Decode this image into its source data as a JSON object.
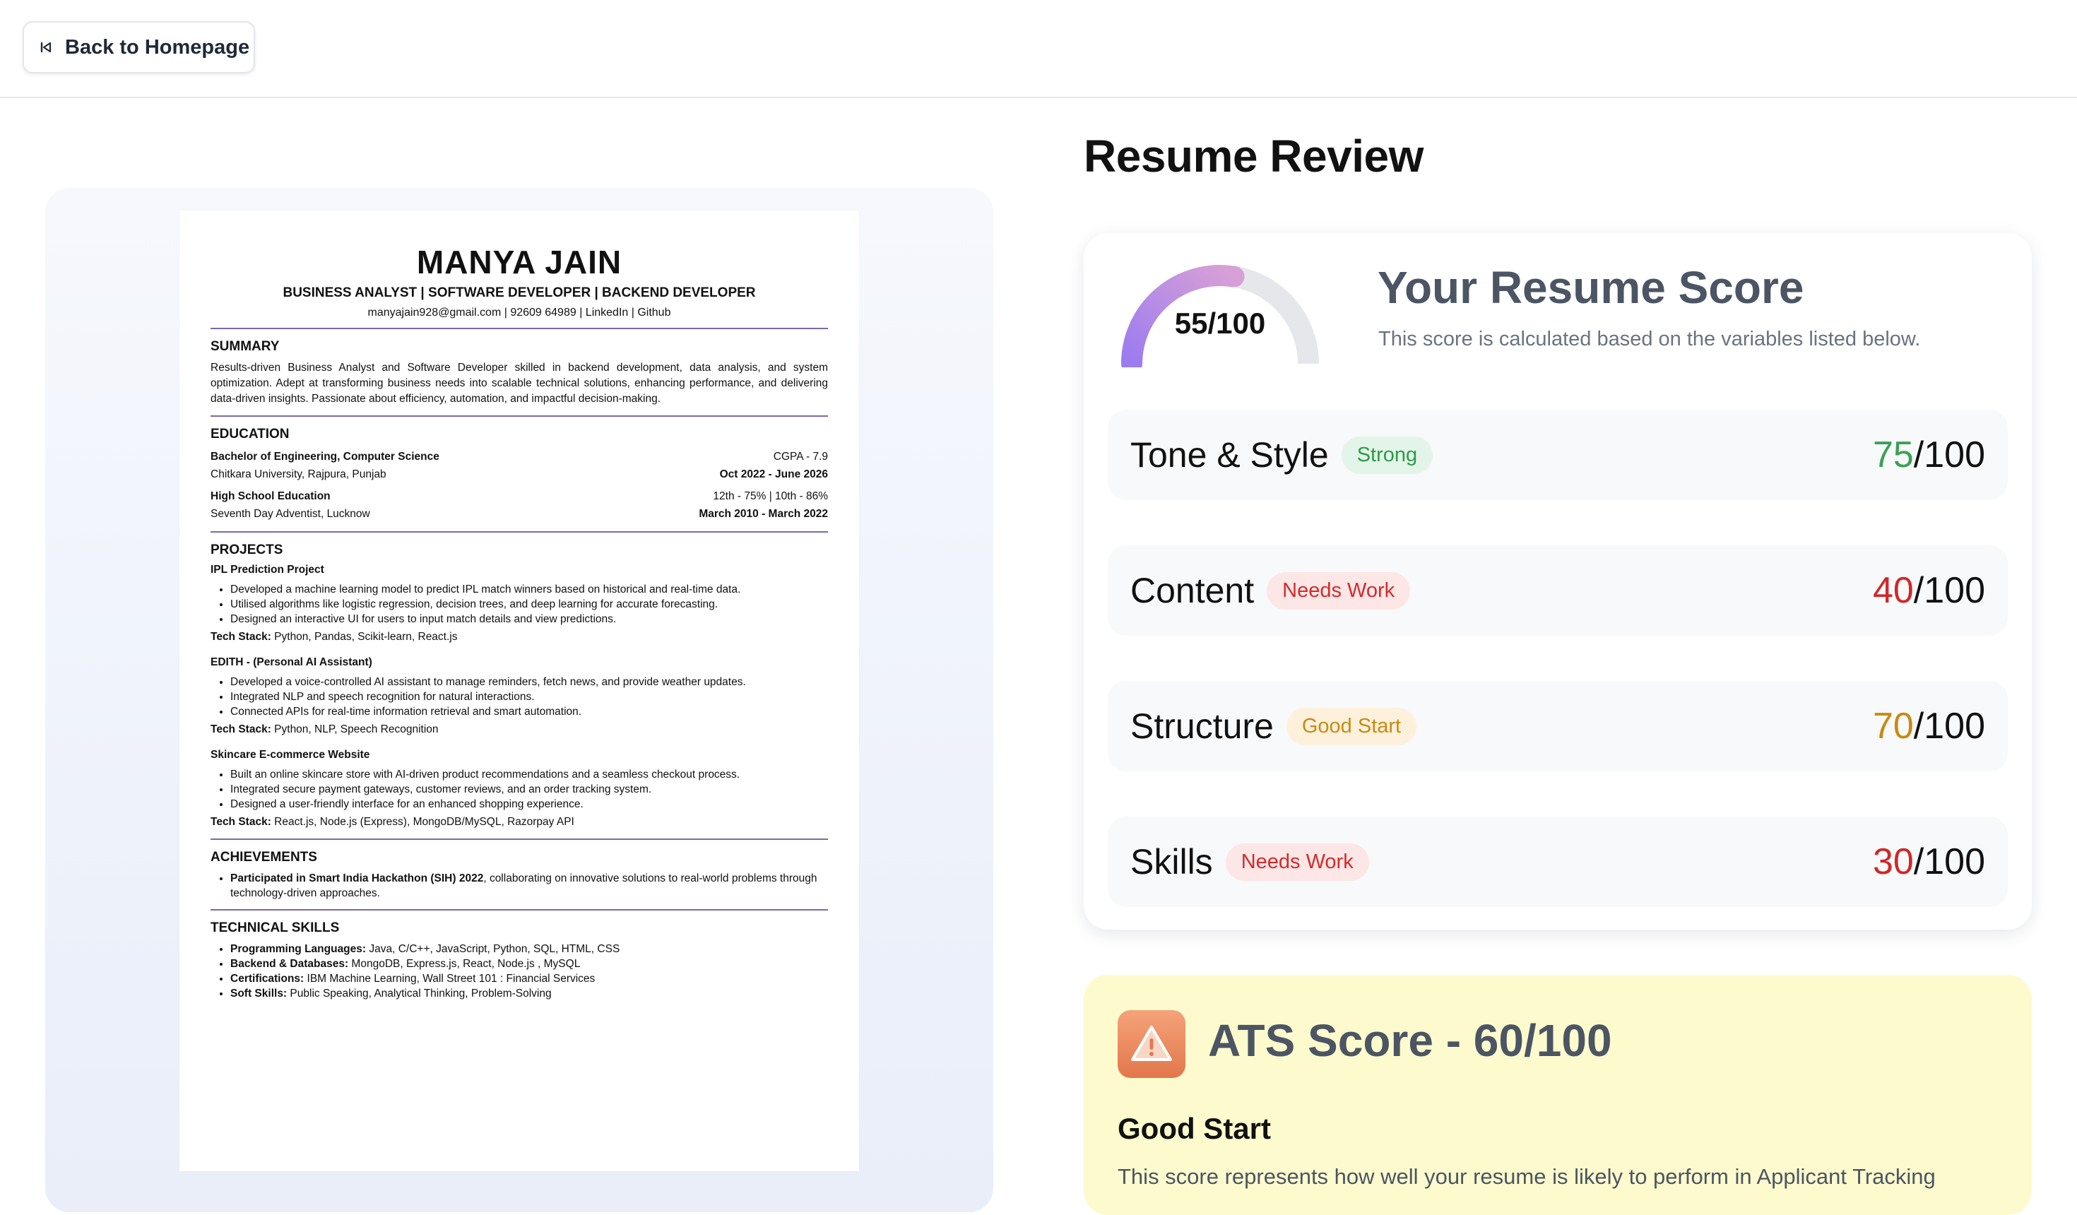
{
  "nav": {
    "back_label": "Back to Homepage"
  },
  "page": {
    "title": "Resume Review"
  },
  "resume": {
    "name": "MANYA JAIN",
    "roles": "BUSINESS ANALYST | SOFTWARE DEVELOPER | BACKEND DEVELOPER",
    "contact": "manyajain928@gmail.com | 92609 64989 | LinkedIn | Github",
    "summary_heading": "SUMMARY",
    "summary": "Results-driven Business Analyst and Software Developer skilled in backend development, data analysis, and system optimization. Adept at transforming business needs into scalable technical solutions, enhancing performance, and delivering data-driven insights. Passionate about efficiency, automation, and impactful decision-making.",
    "education_heading": "EDUCATION",
    "edu1_degree": "Bachelor of Engineering, Computer Science",
    "edu1_grade": "CGPA - 7.9",
    "edu1_school": "Chitkara University, Rajpura, Punjab",
    "edu1_dates": "Oct 2022 - June 2026",
    "edu2_degree": "High School Education",
    "edu2_grade": "12th - 75% | 10th - 86%",
    "edu2_school": "Seventh Day Adventist, Lucknow",
    "edu2_dates": "March 2010 - March 2022",
    "projects_heading": "PROJECTS",
    "p1_title": "IPL Prediction Project",
    "p1_b1": "Developed a machine learning model to predict IPL match winners based on historical and real-time data.",
    "p1_b2": "Utilised algorithms like logistic regression, decision trees, and deep learning for accurate forecasting.",
    "p1_b3": "Designed an interactive UI for users to input match details and view predictions.",
    "tech_label": "Tech Stack:",
    "p1_tech": "Python, Pandas, Scikit-learn, React.js",
    "p2_title": "EDITH -  (Personal AI Assistant)",
    "p2_b1": "Developed a voice-controlled AI assistant to manage reminders, fetch news, and provide weather updates.",
    "p2_b2": "Integrated NLP and speech recognition for natural interactions.",
    "p2_b3": "Connected APIs for real-time information retrieval and smart automation.",
    "p2_tech": "Python, NLP, Speech Recognition",
    "p3_title": "Skincare E-commerce Website",
    "p3_b1": "Built an online skincare store with AI-driven product recommendations and a seamless checkout process.",
    "p3_b2": "Integrated secure payment gateways, customer reviews, and an order tracking system.",
    "p3_b3": "Designed a user-friendly interface for an enhanced shopping experience.",
    "p3_tech": "React.js, Node.js (Express), MongoDB/MySQL, Razorpay API",
    "achievements_heading": "ACHIEVEMENTS",
    "ach_bold": "Participated in Smart India Hackathon (SIH) 2022",
    "ach_rest": ", collaborating on innovative solutions to real-world problems through technology-driven approaches.",
    "skills_heading": "TECHNICAL SKILLS",
    "s1_label": "Programming Languages:",
    "s1_val": " Java, C/C++, JavaScript, Python, SQL, HTML, CSS",
    "s2_label": "Backend & Databases:",
    "s2_val": " MongoDB, Express.js, React, Node.js , MySQL",
    "s3_label": "Certifications:",
    "s3_val": " IBM Machine Learning, Wall Street 101 : Financial Services",
    "s4_label": "Soft Skills:",
    "s4_val": " Public Speaking, Analytical Thinking, Problem-Solving"
  },
  "score": {
    "value": 55,
    "max": 100,
    "display": "55/100",
    "title": "Your Resume Score",
    "subtitle": "This score is calculated based on the variables listed below.",
    "gauge_track": "#e5e7eb",
    "gauge_from": "#9b7bf0",
    "gauge_to": "#d7a0d6"
  },
  "categories": [
    {
      "name": "Tone & Style",
      "badge": "Strong",
      "score": "75",
      "max": "/100"
    },
    {
      "name": "Content",
      "badge": "Needs Work",
      "score": "40",
      "max": "/100"
    },
    {
      "name": "Structure",
      "badge": "Good Start",
      "score": "70",
      "max": "/100"
    },
    {
      "name": "Skills",
      "badge": "Needs Work",
      "score": "30",
      "max": "/100"
    }
  ],
  "ats": {
    "title": "ATS Score - 60/100",
    "subtitle": "Good Start",
    "description": "This score represents how well your resume is likely to perform in Applicant Tracking",
    "icon": "warning-icon"
  }
}
